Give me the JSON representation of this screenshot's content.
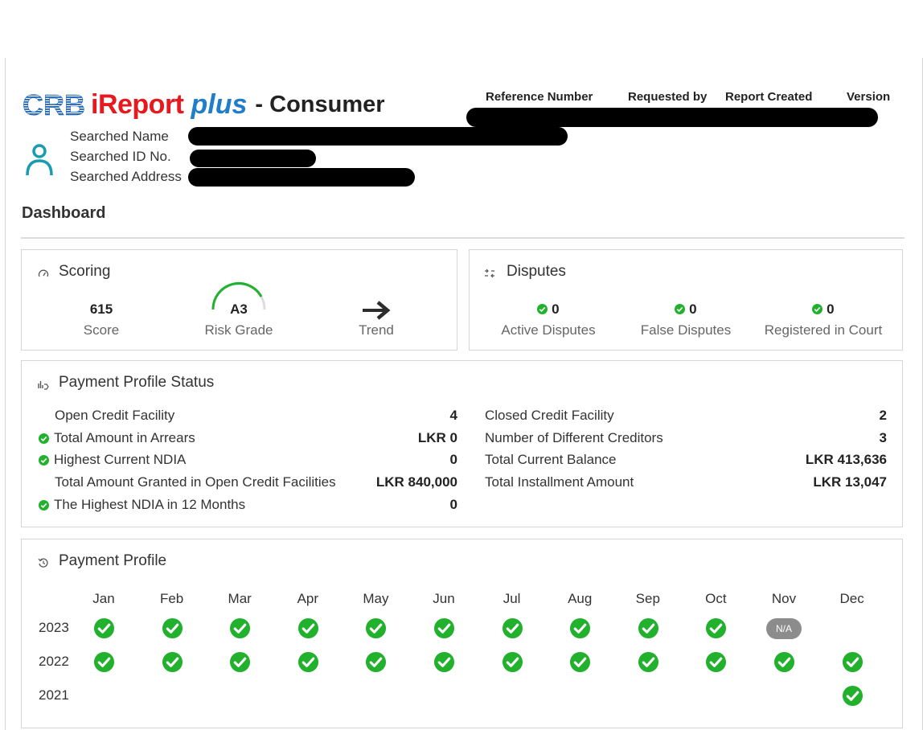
{
  "header": {
    "brand": "CRB",
    "product": "iReport",
    "product_suffix": "plus",
    "report_type": "- Consumer",
    "columns": [
      "Reference Number",
      "Requested by",
      "Report Created",
      "Version"
    ]
  },
  "subject": {
    "labels": [
      "Searched Name",
      "Searched ID No.",
      "Searched Address"
    ]
  },
  "dashboard": {
    "title": "Dashboard"
  },
  "scoring": {
    "title": "Scoring",
    "score_value": "615",
    "score_label": "Score",
    "risk_value": "A3",
    "risk_label": "Risk Grade",
    "trend_label": "Trend",
    "trend_icon": "arrow-right-icon"
  },
  "disputes": {
    "title": "Disputes",
    "items": [
      {
        "value": "0",
        "label": "Active Disputes"
      },
      {
        "value": "0",
        "label": "False Disputes"
      },
      {
        "value": "0",
        "label": "Registered in Court"
      }
    ]
  },
  "payment_profile_status": {
    "title": "Payment Profile Status",
    "left": [
      {
        "label": "Open Credit Facility",
        "value": "4",
        "check": false
      },
      {
        "label": "Total Amount in Arrears",
        "value": "LKR 0",
        "check": true
      },
      {
        "label": "Highest Current NDIA",
        "value": "0",
        "check": true
      },
      {
        "label": "Total Amount Granted in Open Credit Facilities",
        "value": "LKR 840,000",
        "check": false
      },
      {
        "label": "The Highest NDIA in 12 Months",
        "value": "0",
        "check": true
      }
    ],
    "right": [
      {
        "label": "Closed Credit Facility",
        "value": "2"
      },
      {
        "label": "Number of Different Creditors",
        "value": "3"
      },
      {
        "label": "Total Current Balance",
        "value": "LKR 413,636"
      },
      {
        "label": "Total Installment Amount",
        "value": "LKR 13,047"
      }
    ]
  },
  "payment_profile": {
    "title": "Payment Profile",
    "months": [
      "Jan",
      "Feb",
      "Mar",
      "Apr",
      "May",
      "Jun",
      "Jul",
      "Aug",
      "Sep",
      "Oct",
      "Nov",
      "Dec"
    ],
    "years": [
      {
        "year": "2023",
        "status": [
          "ok",
          "ok",
          "ok",
          "ok",
          "ok",
          "ok",
          "ok",
          "ok",
          "ok",
          "ok",
          "na",
          ""
        ]
      },
      {
        "year": "2022",
        "status": [
          "ok",
          "ok",
          "ok",
          "ok",
          "ok",
          "ok",
          "ok",
          "ok",
          "ok",
          "ok",
          "ok",
          "ok"
        ]
      },
      {
        "year": "2021",
        "status": [
          "",
          "",
          "",
          "",
          "",
          "",
          "",
          "",
          "",
          "",
          "",
          "ok"
        ]
      }
    ],
    "na_label": "N/A"
  },
  "colors": {
    "ok_green": "#22b12d",
    "brand_red": "#e8191e",
    "brand_blue": "#1f7dc9",
    "na_gray": "#8c8c8c"
  }
}
